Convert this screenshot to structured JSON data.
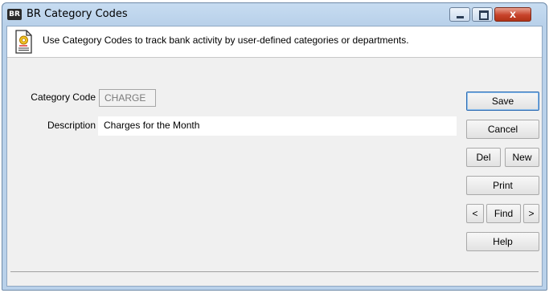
{
  "window": {
    "app_badge": "BR",
    "title": "BR Category Codes",
    "close_glyph": "x"
  },
  "info": {
    "icon": "document-gear-icon",
    "text": "Use Category Codes to track bank activity by user-defined categories or departments."
  },
  "form": {
    "category_code_label": "Category Code",
    "category_code_value": "CHARGE",
    "description_label": "Description",
    "description_value": "Charges for the Month"
  },
  "buttons": {
    "save": "Save",
    "cancel": "Cancel",
    "del": "Del",
    "new": "New",
    "print": "Print",
    "prev": "<",
    "find": "Find",
    "next": ">",
    "help": "Help"
  },
  "colors": {
    "title_bar": "#b9d1ea",
    "client_bg": "#f0f0f0",
    "close_button": "#c7432a",
    "default_button_border": "#2f6db3"
  }
}
